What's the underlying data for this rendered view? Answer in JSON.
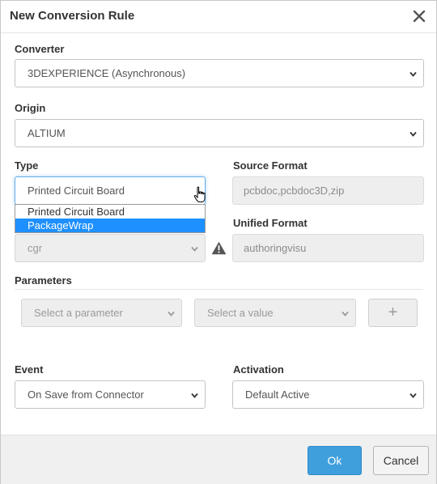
{
  "dialog": {
    "title": "New Conversion Rule"
  },
  "converter": {
    "label": "Converter",
    "value": "3DEXPERIENCE (Asynchronous)"
  },
  "origin": {
    "label": "Origin",
    "value": "ALTIUM"
  },
  "type": {
    "label": "Type",
    "value": "Printed Circuit Board",
    "options": [
      "Printed Circuit Board",
      "PackageWrap"
    ],
    "highlighted_option": "PackageWrap"
  },
  "source_format": {
    "label": "Source Format",
    "value": "pcbdoc,pcbdoc3D,zip"
  },
  "target": {
    "value": "cgr"
  },
  "unified_format": {
    "label": "Unified Format",
    "value": "authoringvisu"
  },
  "parameters": {
    "label": "Parameters",
    "parameter_placeholder": "Select a parameter",
    "value_placeholder": "Select a value",
    "add_label": "+"
  },
  "event": {
    "label": "Event",
    "value": "On Save from Connector"
  },
  "activation": {
    "label": "Activation",
    "value": "Default Active"
  },
  "footer": {
    "ok_label": "Ok",
    "cancel_label": "Cancel"
  },
  "colors": {
    "primary_button": "#3f9fdd",
    "dropdown_highlight": "#1e90ff",
    "warning_icon": "#555555"
  },
  "icons": {
    "close": "close-icon",
    "chevron": "chevron-down-icon",
    "warning": "warning-icon",
    "plus": "plus-icon"
  }
}
